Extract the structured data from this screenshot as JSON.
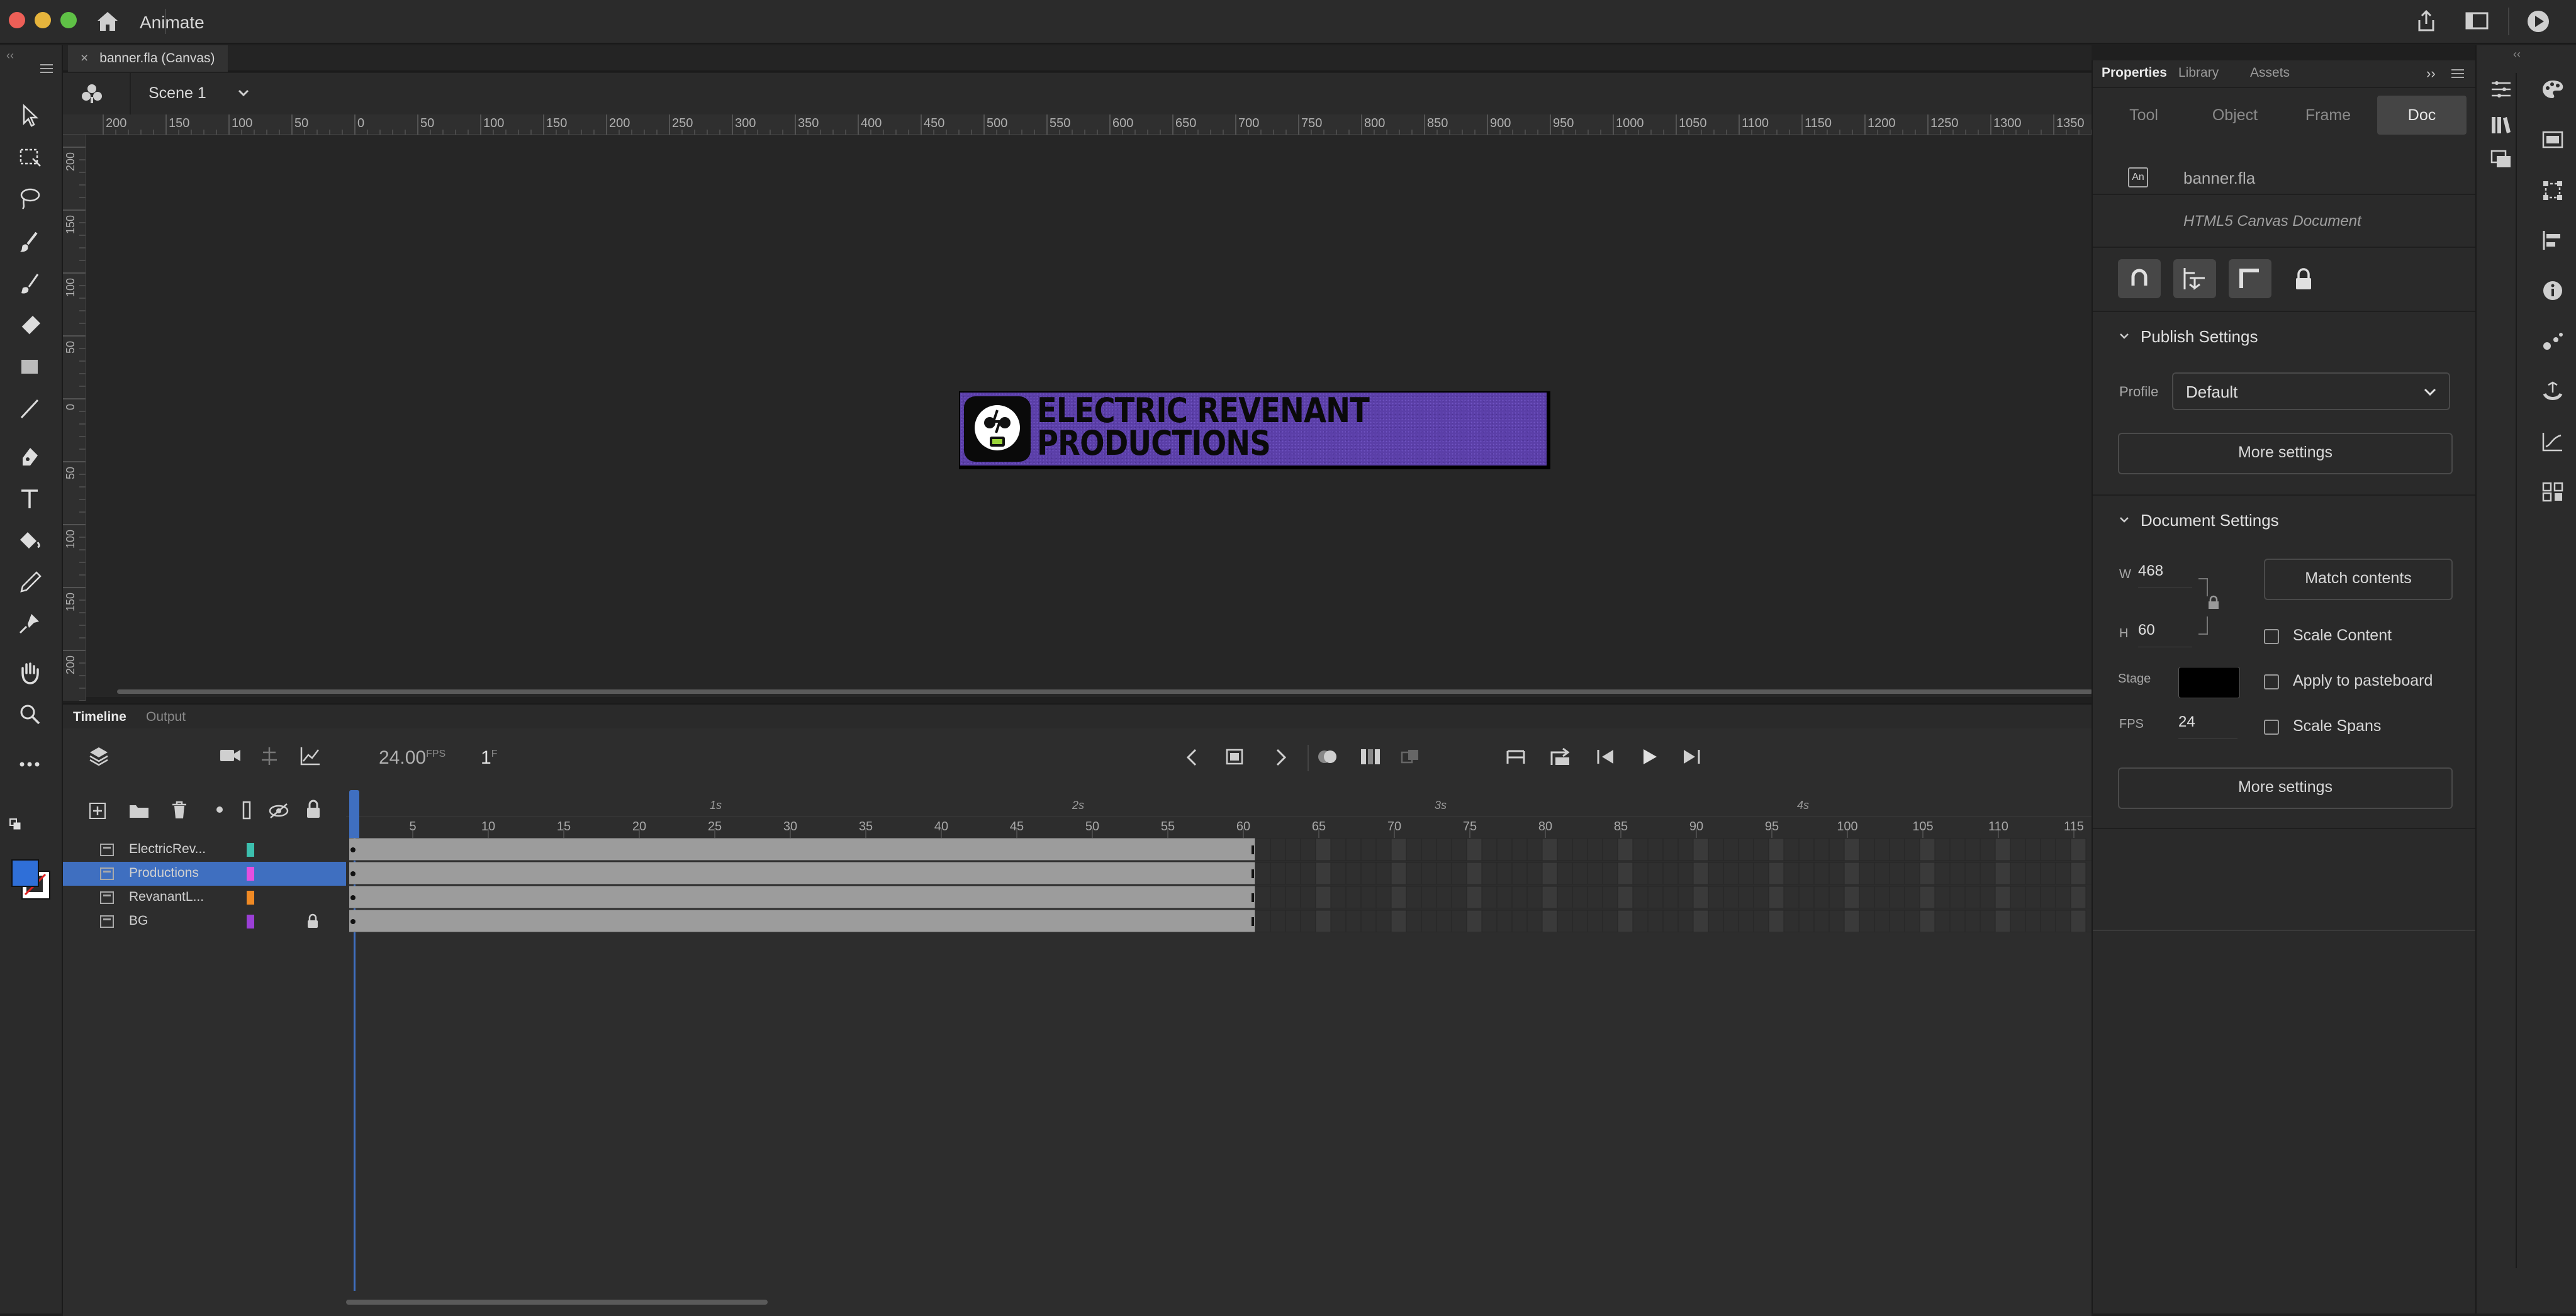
{
  "titlebar": {
    "app_name": "Animate",
    "traffic_colors": [
      "#ed5f57",
      "#e6b43c",
      "#5fc146"
    ]
  },
  "document": {
    "tab_label": "banner.fla (Canvas)",
    "close_glyph": "×"
  },
  "scene": {
    "label": "Scene 1"
  },
  "rulers": {
    "h_ticks": [
      "200",
      "150",
      "100",
      "50",
      "0",
      "50",
      "100",
      "150",
      "200",
      "250",
      "300",
      "350",
      "400",
      "450",
      "500",
      "550",
      "600",
      "650",
      "700",
      "750",
      "800",
      "850",
      "900",
      "950",
      "1000",
      "1050",
      "1100",
      "1150",
      "1200",
      "1250",
      "1300",
      "1350"
    ],
    "v_ticks": [
      "200",
      "150",
      "100",
      "50",
      "0",
      "50",
      "100",
      "150",
      "200"
    ]
  },
  "banner": {
    "line1": "ELECTRIC REVENANT",
    "line2": "PRODUCTIONS",
    "bg_color": "#5b3fa8"
  },
  "timeline": {
    "tabs": [
      "Timeline",
      "Output"
    ],
    "fps_value": "24.00",
    "fps_unit": "FPS",
    "frame_value": "1",
    "frame_unit": "F",
    "second_labels": [
      "1s",
      "2s",
      "3s",
      "4s"
    ],
    "frame_numbers": [
      "5",
      "10",
      "15",
      "20",
      "25",
      "30",
      "35",
      "40",
      "45",
      "50",
      "55",
      "60",
      "65",
      "70",
      "75",
      "80",
      "85",
      "90",
      "95",
      "100",
      "105",
      "110",
      "115"
    ],
    "layers": [
      {
        "name": "ElectricRev...",
        "color": "#3cbfae",
        "selected": false,
        "locked": false
      },
      {
        "name": "Productions",
        "color": "#e54fe0",
        "selected": true,
        "locked": false
      },
      {
        "name": "RevanantL...",
        "color": "#f08a24",
        "selected": false,
        "locked": false
      },
      {
        "name": "BG",
        "color": "#9b3fd6",
        "selected": false,
        "locked": true
      }
    ],
    "span_frames": 60
  },
  "properties": {
    "tabs": [
      "Properties",
      "Library",
      "Assets"
    ],
    "subtabs": [
      "Tool",
      "Object",
      "Frame",
      "Doc"
    ],
    "active_subtab": "Doc",
    "file_name": "banner.fla",
    "doc_type": "HTML5 Canvas Document",
    "badge": "An",
    "publish": {
      "title": "Publish Settings",
      "profile_label": "Profile",
      "profile_value": "Default",
      "more_settings": "More settings"
    },
    "docsettings": {
      "title": "Document Settings",
      "w_label": "W",
      "w_value": "468",
      "h_label": "H",
      "h_value": "60",
      "match_contents": "Match contents",
      "scale_content": "Scale Content",
      "apply_pasteboard": "Apply to pasteboard",
      "scale_spans": "Scale Spans",
      "stage_label": "Stage",
      "stage_color": "#000000",
      "fps_label": "FPS",
      "fps_value": "24",
      "more_settings": "More settings"
    }
  },
  "colors": {
    "accent": "#3f6fc0",
    "fill_swatch": "#2f6fd8",
    "stroke_swatch": "#ffffff"
  }
}
